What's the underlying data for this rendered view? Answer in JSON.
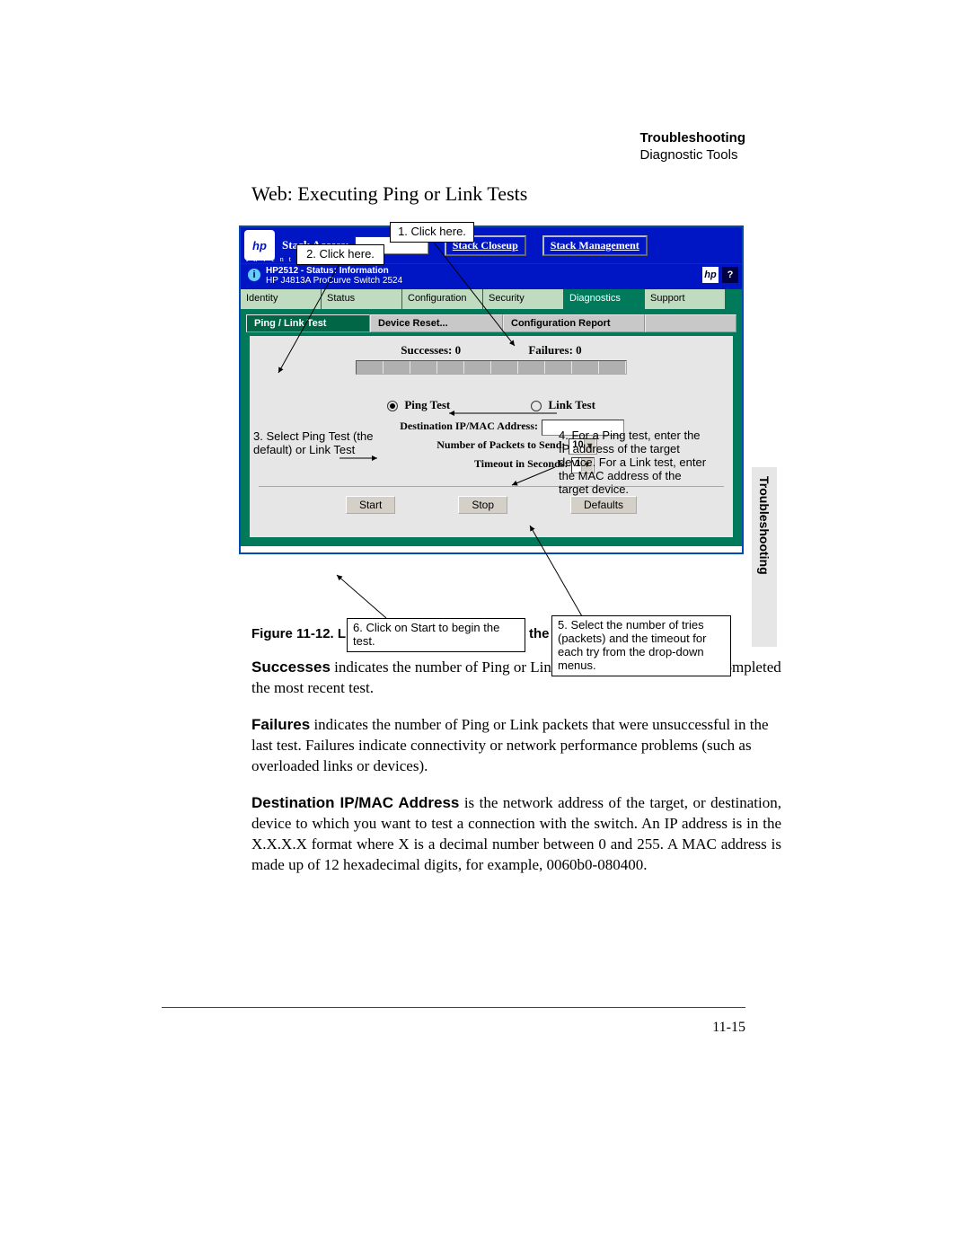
{
  "header": {
    "bold": "Troubleshooting",
    "sub": "Diagnostic Tools"
  },
  "title": "Web: Executing Ping or Link Tests",
  "annotations": {
    "c1": "1. Click here.",
    "c2": "2. Click here.",
    "c3": "3. Select Ping Test (the default) or Link Test",
    "c4": "4. For a Ping test, enter the IP address of the target device. For a Link test, enter the MAC address of the target   device.",
    "c5": "5.  Select the number of tries (packets) and the timeout for each try from  the drop-down menus.",
    "c6": "6. Click on Start to begin the test."
  },
  "screen": {
    "hp_logo": "hp",
    "invent": "i n v e n t",
    "stack_access_label": "Stack Access:",
    "btn_closeup": "Stack Closeup",
    "btn_mgmt": "Stack Management",
    "status_line1": "HP2512 - Status: Information",
    "status_line2": "HP J4813A ProCurve Switch 2524",
    "help_icon": "?",
    "nav": [
      "Identity",
      "Status",
      "Configuration",
      "Security",
      "Diagnostics",
      "Support"
    ],
    "nav_selected_index": 4,
    "toolbar": [
      "Ping / Link Test",
      "Device Reset...",
      "Configuration Report"
    ],
    "toolbar_selected_index": 0,
    "successes_label": "Successes: 0",
    "failures_label": "Failures: 0",
    "radio_ping": "Ping Test",
    "radio_link": "Link Test",
    "form": {
      "dest_label": "Destination IP/MAC Address:",
      "packets_label": "Number of Packets to Send:",
      "packets_value": "10",
      "timeout_label": "Timeout in Seconds:",
      "timeout_value": "1"
    },
    "buttons": {
      "start": "Start",
      "stop": "Stop",
      "defaults": "Defaults"
    }
  },
  "caption": "Figure 11-12. Link and Ping Test Screen on the Web Browser Interface",
  "body": {
    "p1a": "Successes",
    "p1b": " indicates the number of Ping or Link packets that successfully completed the most recent test.",
    "p2a": "Failures",
    "p2b": " indicates the number of Ping or Link packets that were unsuccessful in the last test. Failures indicate connectivity or network performance problems (such as overloaded links or devices).",
    "p3a": "Destination IP/MAC Address",
    "p3b": " is the network address of the target, or destination, device to which you want to test a connection with the switch. An IP address is in the X.X.X.X format where X is a decimal number between 0 and 255. A MAC address is made up of 12 hexadecimal digits, for example, 0060b0-080400."
  },
  "sidetab": "Troubleshooting",
  "pagenum": "11-15"
}
